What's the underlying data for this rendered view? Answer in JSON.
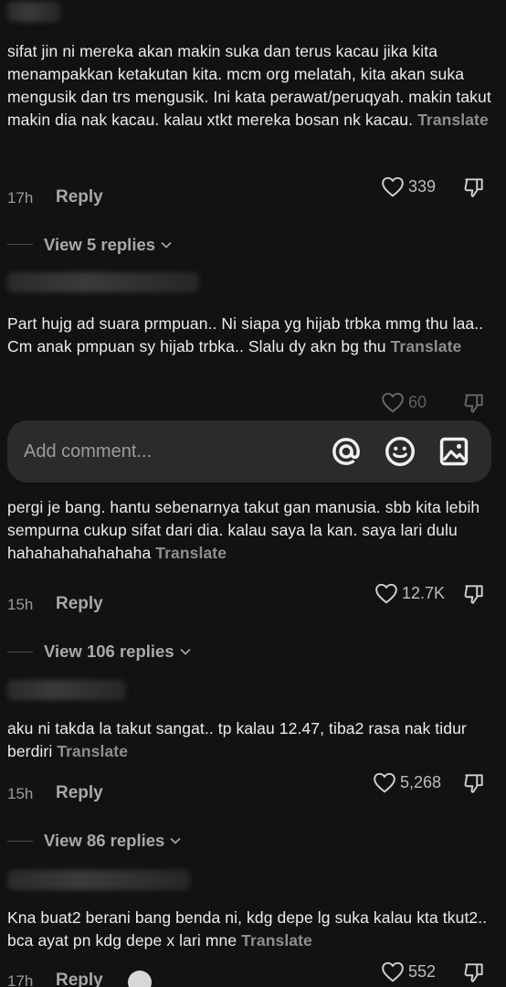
{
  "comments": [
    {
      "text": "sifat jin ni mereka akan makin suka dan terus kacau jika kita menampakkan ketakutan kita. mcm org melatah, kita akan suka mengusik dan trs mengusik. Ini kata perawat/peruqyah. makin takut makin dia nak kacau. kalau xtkt mereka bosan nk kacau.",
      "translate": "Translate",
      "time": "17h",
      "reply": "Reply",
      "likes": "339",
      "view_replies": "View 5 replies"
    },
    {
      "text": "Part hujg ad suara prmpuan.. Ni siapa yg hijab trbka mmg thu laa.. Cm anak pmpuan sy hijab trbka.. Slalu dy akn bg thu",
      "translate": "Translate",
      "likes": "60"
    },
    {
      "text": "pergi je bang. hantu sebenarnya takut gan manusia. sbb kita lebih sempurna cukup sifat dari dia. kalau saya la kan. saya lari dulu hahahahahahahaha",
      "translate": "Translate",
      "time": "15h",
      "reply": "Reply",
      "likes": "12.7K",
      "view_replies": "View 106 replies"
    },
    {
      "text": "aku ni takda la takut sangat.. tp kalau 12.47, tiba2 rasa nak tidur berdiri",
      "translate": "Translate",
      "time": "15h",
      "reply": "Reply",
      "likes": "5,268",
      "view_replies": "View 86 replies"
    },
    {
      "text": "Kna buat2 berani bang benda ni, kdg depe lg suka kalau kta tkut2.. bca ayat pn kdg depe x lari mne",
      "translate": "Translate",
      "time": "17h",
      "reply": "Reply",
      "likes": "552"
    }
  ],
  "composer": {
    "placeholder": "Add comment..."
  },
  "icons": {
    "like": "heart-outline-icon",
    "dislike": "thumbs-down-outline-icon",
    "mention": "at-sign-icon",
    "emoji": "smiley-icon",
    "image": "image-icon"
  }
}
